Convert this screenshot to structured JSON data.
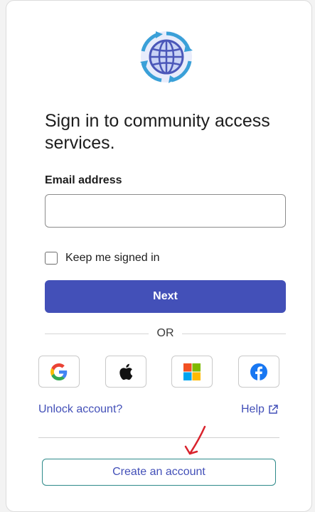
{
  "header": {
    "title": "Sign in to community access services."
  },
  "form": {
    "email_label": "Email address",
    "email_value": "",
    "email_placeholder": "",
    "keep_signed_in_label": "Keep me signed in",
    "keep_signed_in_checked": false,
    "next_label": "Next"
  },
  "divider": {
    "or_label": "OR"
  },
  "social": [
    {
      "icon": "google-icon"
    },
    {
      "icon": "apple-icon"
    },
    {
      "icon": "microsoft-icon"
    },
    {
      "icon": "facebook-icon"
    }
  ],
  "links": {
    "unlock_label": "Unlock account?",
    "help_label": "Help"
  },
  "footer": {
    "create_account_label": "Create an account"
  },
  "colors": {
    "accent": "#4350b8",
    "create_border": "#2e8a8a",
    "annotation": "#d9232d",
    "facebook": "#1877f2"
  }
}
